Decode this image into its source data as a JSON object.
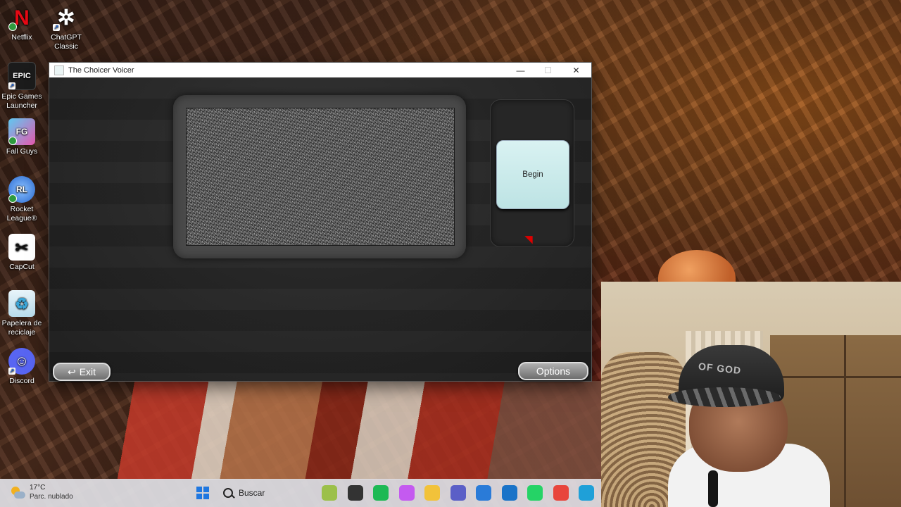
{
  "desktop": {
    "icons": [
      {
        "label": "Netflix",
        "icon": "netflix-icon",
        "color": "#e50914",
        "glyph": "N"
      },
      {
        "label": "ChatGPT Classic",
        "icon": "chatgpt-icon",
        "color": "#ffffff",
        "glyph": "✲"
      },
      {
        "label": "Epic Games Launcher",
        "icon": "epic-games-icon",
        "color": "#1b1b1b",
        "glyph": "EPIC"
      },
      {
        "label": "Fall Guys",
        "icon": "fall-guys-icon",
        "color": "#5ec8f0",
        "glyph": "FG"
      },
      {
        "label": "Rocket League®",
        "icon": "rocket-league-icon",
        "color": "#2a6ad0",
        "glyph": "RL"
      },
      {
        "label": "CapCut",
        "icon": "capcut-icon",
        "color": "#111111",
        "glyph": "✂"
      },
      {
        "label": "Papelera de reciclaje",
        "icon": "recycle-bin-icon",
        "color": "#3aa6d8",
        "glyph": "♻"
      },
      {
        "label": "Discord",
        "icon": "discord-icon",
        "color": "#5865f2",
        "glyph": "☺"
      }
    ]
  },
  "window": {
    "title": "The Choicer Voicer",
    "minimize": "—",
    "maximize": "☐",
    "close": "✕",
    "begin_label": "Begin",
    "exit_label": "Exit",
    "exit_icon": "↩",
    "options_label": "Options"
  },
  "webcam": {
    "cap_text": "OF GOD"
  },
  "taskbar": {
    "weather_temp": "17°C",
    "weather_desc": "Parc. nublado",
    "search_placeholder": "Buscar",
    "apps": [
      {
        "name": "widgets-app-icon",
        "color": "#9cc04a"
      },
      {
        "name": "task-view-icon",
        "color": "#333333"
      },
      {
        "name": "spotify-icon",
        "color": "#1db954"
      },
      {
        "name": "copilot-icon",
        "color": "#c45af0"
      },
      {
        "name": "file-explorer-icon",
        "color": "#f2c23a"
      },
      {
        "name": "teams-icon",
        "color": "#5b5fc7"
      },
      {
        "name": "store-icon",
        "color": "#2a7bd8"
      },
      {
        "name": "outlook-icon",
        "color": "#1a73c8"
      },
      {
        "name": "whatsapp-icon",
        "color": "#25d366"
      },
      {
        "name": "chrome-icon",
        "color": "#e8453c"
      },
      {
        "name": "edge-icon",
        "color": "#1fa0d8"
      }
    ]
  }
}
